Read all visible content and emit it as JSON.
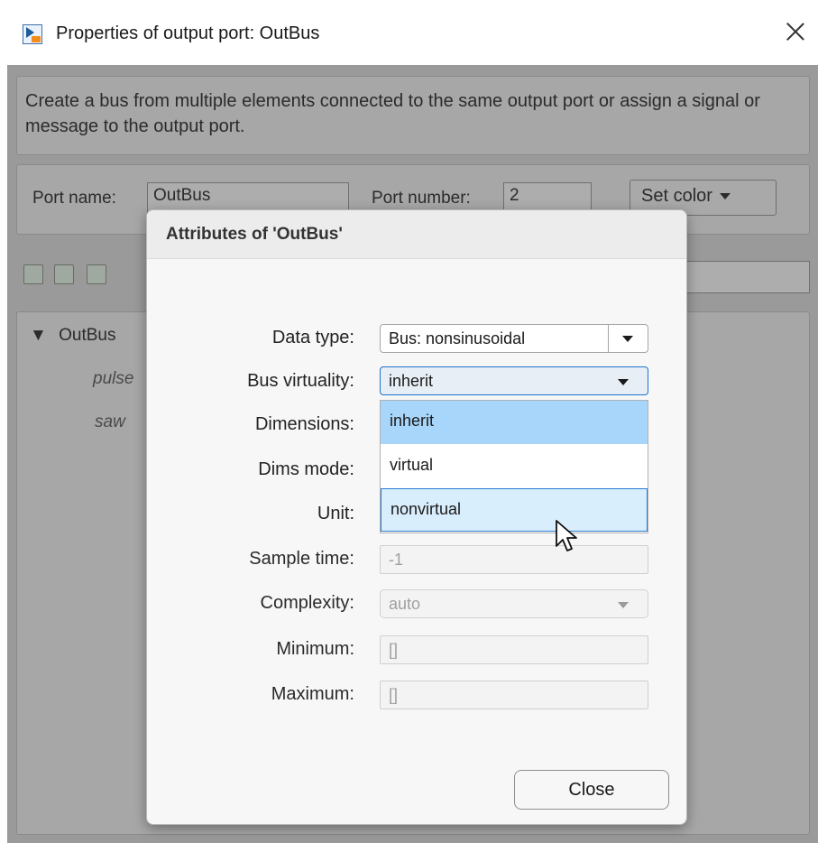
{
  "window": {
    "title": "Properties of output port: OutBus"
  },
  "background": {
    "description": "Create a bus from multiple elements connected to the same output port or assign a signal or message to the output port.",
    "port_name_label": "Port name:",
    "port_name_value": "OutBus",
    "port_number_label": "Port number:",
    "port_number_value": "2",
    "set_color_label": "Set color",
    "tree": {
      "root": "OutBus",
      "children": [
        "pulse",
        "saw"
      ]
    }
  },
  "dialog": {
    "title": "Attributes of 'OutBus'",
    "rows": {
      "data_type": {
        "label": "Data type:",
        "value": "Bus: nonsinusoidal"
      },
      "bus_virtuality": {
        "label": "Bus virtuality:",
        "value": "inherit"
      },
      "dimensions": {
        "label": "Dimensions:"
      },
      "dims_mode": {
        "label": "Dims mode:"
      },
      "unit": {
        "label": "Unit:"
      },
      "sample_time": {
        "label": "Sample time:",
        "value": "-1"
      },
      "complexity": {
        "label": "Complexity:",
        "value": "auto"
      },
      "minimum": {
        "label": "Minimum:",
        "value": "[]"
      },
      "maximum": {
        "label": "Maximum:",
        "value": "[]"
      }
    },
    "bus_virtuality_options": [
      "inherit",
      "virtual",
      "nonvirtual"
    ],
    "selected_option": "inherit",
    "hovered_option": "nonvirtual",
    "close_label": "Close"
  },
  "colors": {
    "selected_option_bg": "#a7d6fa",
    "hover_option_bg": "#d9eefc",
    "focus_border": "#1f72c9",
    "dimmed_background": "#9a9a9a"
  },
  "icons": {
    "app": "simulink-port-icon",
    "close": "close-icon",
    "cursor": "mouse-pointer-icon"
  }
}
